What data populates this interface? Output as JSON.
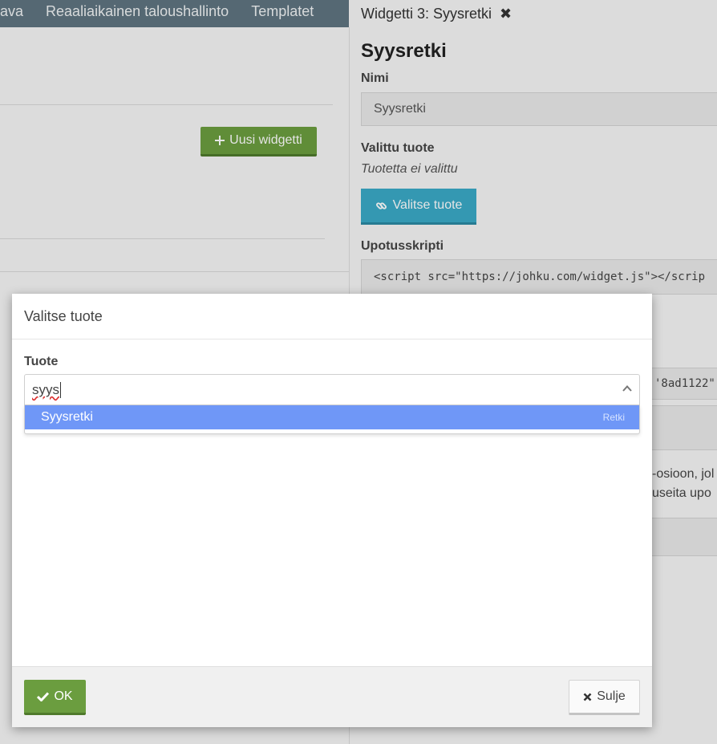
{
  "topnav": {
    "items": [
      "ava",
      "Reaaliaikainen taloushallinto",
      "Templatet"
    ]
  },
  "left": {
    "new_widget_label": "Uusi widgetti"
  },
  "right_panel": {
    "tab_label": "Widgetti 3: Syysretki",
    "title": "Syysretki",
    "name_label": "Nimi",
    "name_value": "Syysretki",
    "selected_product_label": "Valittu tuote",
    "selected_product_value": "Tuotetta ei valittu",
    "select_product_button": "Valitse tuote",
    "embed_script_label": "Upotusskripti",
    "embed_script_value": "<script src=\"https://johku.com/widget.js\"></scrip",
    "embed_code_fragment": "'8ad1122\"",
    "text_fragment_1": "-osioon, jol",
    "text_fragment_2": "useita upo"
  },
  "modal": {
    "title": "Valitse tuote",
    "field_label": "Tuote",
    "search_value": "syys",
    "options": [
      {
        "label": "Syysretki",
        "tag": "Retki"
      }
    ],
    "ok_label": "OK",
    "close_label": "Sulje"
  },
  "colors": {
    "nav_bg": "#5f7480",
    "primary_green": "#6b9d3f",
    "info_blue": "#3aaac7",
    "dropdown_highlight": "#6f97f7"
  }
}
